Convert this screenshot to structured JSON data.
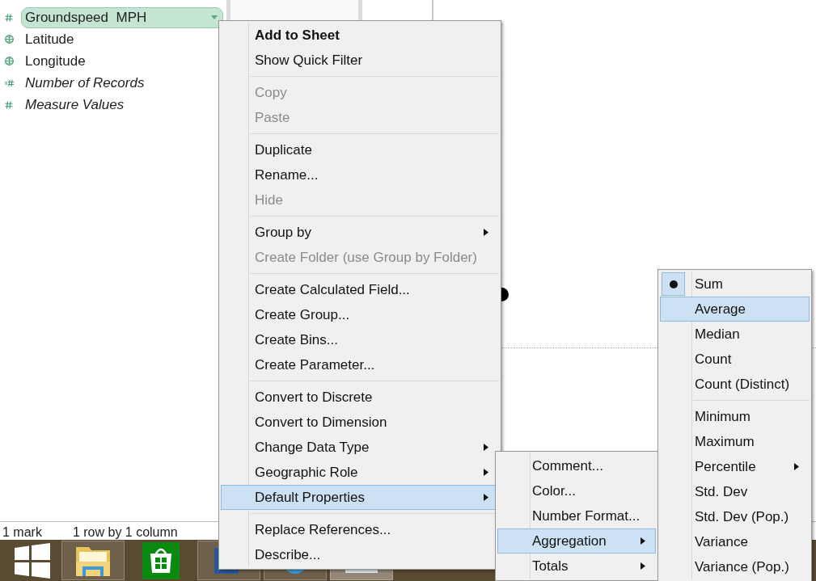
{
  "fields": [
    {
      "name": "Groundspeed  MPH",
      "kind": "measure",
      "italic": false,
      "selected": true
    },
    {
      "name": "Latitude",
      "kind": "geo",
      "italic": false,
      "selected": false
    },
    {
      "name": "Longitude",
      "kind": "geo",
      "italic": false,
      "selected": false
    },
    {
      "name": "Number of Records",
      "kind": "count",
      "italic": true,
      "selected": false
    },
    {
      "name": "Measure Values",
      "kind": "measure",
      "italic": true,
      "selected": false
    }
  ],
  "status_bar": {
    "marks": "1 mark",
    "shape": "1 row by 1 column"
  },
  "context_menu": [
    [
      {
        "label": "Add to Sheet",
        "default": true,
        "disabled": false,
        "submenu": false,
        "selected": false
      },
      {
        "label": "Show Quick Filter",
        "default": false,
        "disabled": false,
        "submenu": false,
        "selected": false
      }
    ],
    [
      {
        "label": "Copy",
        "default": false,
        "disabled": true,
        "submenu": false,
        "selected": false
      },
      {
        "label": "Paste",
        "default": false,
        "disabled": true,
        "submenu": false,
        "selected": false
      }
    ],
    [
      {
        "label": "Duplicate",
        "default": false,
        "disabled": false,
        "submenu": false,
        "selected": false
      },
      {
        "label": "Rename...",
        "default": false,
        "disabled": false,
        "submenu": false,
        "selected": false
      },
      {
        "label": "Hide",
        "default": false,
        "disabled": true,
        "submenu": false,
        "selected": false
      }
    ],
    [
      {
        "label": "Group by",
        "default": false,
        "disabled": false,
        "submenu": true,
        "selected": false
      },
      {
        "label": "Create Folder (use Group by Folder)",
        "default": false,
        "disabled": true,
        "submenu": false,
        "selected": false
      }
    ],
    [
      {
        "label": "Create Calculated Field...",
        "default": false,
        "disabled": false,
        "submenu": false,
        "selected": false
      },
      {
        "label": "Create Group...",
        "default": false,
        "disabled": false,
        "submenu": false,
        "selected": false
      },
      {
        "label": "Create Bins...",
        "default": false,
        "disabled": false,
        "submenu": false,
        "selected": false
      },
      {
        "label": "Create Parameter...",
        "default": false,
        "disabled": false,
        "submenu": false,
        "selected": false
      }
    ],
    [
      {
        "label": "Convert to Discrete",
        "default": false,
        "disabled": false,
        "submenu": false,
        "selected": false
      },
      {
        "label": "Convert to Dimension",
        "default": false,
        "disabled": false,
        "submenu": false,
        "selected": false
      },
      {
        "label": "Change Data Type",
        "default": false,
        "disabled": false,
        "submenu": true,
        "selected": false
      },
      {
        "label": "Geographic Role",
        "default": false,
        "disabled": false,
        "submenu": true,
        "selected": false
      },
      {
        "label": "Default Properties",
        "default": false,
        "disabled": false,
        "submenu": true,
        "selected": true
      }
    ],
    [
      {
        "label": "Replace References...",
        "default": false,
        "disabled": false,
        "submenu": false,
        "selected": false
      },
      {
        "label": "Describe...",
        "default": false,
        "disabled": false,
        "submenu": false,
        "selected": false
      }
    ]
  ],
  "properties_menu": [
    [
      {
        "label": "Comment...",
        "submenu": false,
        "selected": false
      },
      {
        "label": "Color...",
        "submenu": false,
        "selected": false
      },
      {
        "label": "Number Format...",
        "submenu": false,
        "selected": false
      },
      {
        "label": "Aggregation",
        "submenu": true,
        "selected": true
      },
      {
        "label": "Totals",
        "submenu": true,
        "selected": false
      }
    ]
  ],
  "aggregation_menu": [
    [
      {
        "label": "Sum",
        "submenu": false,
        "selected": false,
        "checked": true
      },
      {
        "label": "Average",
        "submenu": false,
        "selected": true,
        "checked": false
      },
      {
        "label": "Median",
        "submenu": false,
        "selected": false,
        "checked": false
      },
      {
        "label": "Count",
        "submenu": false,
        "selected": false,
        "checked": false
      },
      {
        "label": "Count (Distinct)",
        "submenu": false,
        "selected": false,
        "checked": false
      }
    ],
    [
      {
        "label": "Minimum",
        "submenu": false,
        "selected": false,
        "checked": false
      },
      {
        "label": "Maximum",
        "submenu": false,
        "selected": false,
        "checked": false
      },
      {
        "label": "Percentile",
        "submenu": true,
        "selected": false,
        "checked": false
      },
      {
        "label": "Std. Dev",
        "submenu": false,
        "selected": false,
        "checked": false
      },
      {
        "label": "Std. Dev (Pop.)",
        "submenu": false,
        "selected": false,
        "checked": false
      },
      {
        "label": "Variance",
        "submenu": false,
        "selected": false,
        "checked": false
      },
      {
        "label": "Variance (Pop.)",
        "submenu": false,
        "selected": false,
        "checked": false
      }
    ]
  ]
}
